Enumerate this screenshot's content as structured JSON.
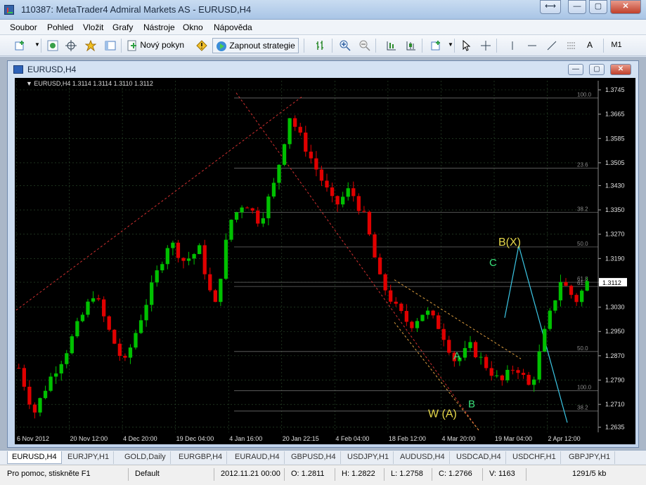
{
  "window": {
    "title": "110387: MetaTrader4 Admiral Markets AS - EURUSD,H4",
    "minimize": "⟷",
    "restore_a": "—",
    "restore_b": "▢",
    "close": "✕"
  },
  "menu": [
    "Soubor",
    "Pohled",
    "Vložit",
    "Grafy",
    "Nástroje",
    "Okno",
    "Nápověda"
  ],
  "toolbar": {
    "new_order": "Nový pokyn",
    "start_strategy": "Zapnout strategie",
    "text_tool": "A",
    "timeframe": "M1",
    "icons": [
      "new-chart-icon",
      "profiles-icon",
      "crosshair-icon",
      "favorites-icon",
      "navigator-icon",
      "warning-icon",
      "expert-icon",
      "bar-chart-icon",
      "zoom-in-icon",
      "zoom-out-icon",
      "grid-icon",
      "candle-icon",
      "templates-icon",
      "cursor-icon",
      "crosshair-tool-icon",
      "vertical-line-icon",
      "horizontal-line-icon",
      "trendline-icon",
      "fibo-icon"
    ]
  },
  "chart_window": {
    "title": "EURUSD,H4",
    "minimize": "—",
    "restore": "▢",
    "close": "✕"
  },
  "chart_data": {
    "type": "candlestick",
    "symbol_info": "EURUSD,H4  1.3114 1.3114 1.3110 1.3112",
    "background": "#000000",
    "up_color": "#00c000",
    "down_color": "#e00000",
    "current_price_label": "1.3112",
    "y_ticks": [
      "1.3745",
      "1.3665",
      "1.3585",
      "1.3505",
      "1.3430",
      "1.3350",
      "1.3270",
      "1.3190",
      "1.3112",
      "1.3030",
      "1.2950",
      "1.2870",
      "1.2790",
      "1.2710",
      "1.2635"
    ],
    "y_tick_values": [
      1.3745,
      1.3665,
      1.3585,
      1.3505,
      1.343,
      1.335,
      1.327,
      1.319,
      1.3112,
      1.303,
      1.295,
      1.287,
      1.279,
      1.271,
      1.2635
    ],
    "ylim": [
      1.2618,
      1.3775
    ],
    "x_ticks": [
      "6 Nov 2012",
      "20 Nov 12:00",
      "4 Dec 20:00",
      "19 Dec 04:00",
      "4 Jan 16:00",
      "20 Jan 22:15",
      "4 Feb 04:00",
      "18 Feb 12:00",
      "4 Mar 20:00",
      "19 Mar 04:00",
      "2 Apr 12:00"
    ],
    "x_tick_index": [
      0,
      10,
      20,
      30,
      40,
      50,
      60,
      70,
      80,
      90,
      100
    ],
    "bar_count": 108,
    "path": [
      [
        0,
        1.283
      ],
      [
        4,
        1.268
      ],
      [
        8,
        1.279
      ],
      [
        12,
        1.287
      ],
      [
        16,
        1.298
      ],
      [
        20,
        1.308
      ],
      [
        24,
        1.295
      ],
      [
        28,
        1.284
      ],
      [
        32,
        1.298
      ],
      [
        36,
        1.312
      ],
      [
        40,
        1.325
      ],
      [
        44,
        1.318
      ],
      [
        48,
        1.322
      ],
      [
        52,
        1.302
      ],
      [
        56,
        1.331
      ],
      [
        60,
        1.338
      ],
      [
        64,
        1.331
      ],
      [
        68,
        1.344
      ],
      [
        72,
        1.366
      ],
      [
        76,
        1.356
      ],
      [
        80,
        1.346
      ],
      [
        84,
        1.336
      ],
      [
        88,
        1.342
      ],
      [
        92,
        1.332
      ],
      [
        96,
        1.312
      ],
      [
        100,
        1.303
      ],
      [
        104,
        1.297
      ],
      [
        108,
        1.302
      ],
      [
        112,
        1.296
      ],
      [
        116,
        1.285
      ],
      [
        120,
        1.29
      ],
      [
        124,
        1.284
      ],
      [
        128,
        1.278
      ],
      [
        132,
        1.284
      ],
      [
        136,
        1.276
      ],
      [
        140,
        1.296
      ],
      [
        144,
        1.312
      ],
      [
        148,
        1.305
      ],
      [
        151,
        1.311
      ]
    ],
    "fibo_levels": [
      {
        "label": "100.0",
        "value": 1.3718
      },
      {
        "label": "23.6",
        "value": 1.3487
      },
      {
        "label": "38.2",
        "value": 1.3342
      },
      {
        "label": "50.0",
        "value": 1.3228
      },
      {
        "label": "61.8",
        "value": 1.3112
      },
      {
        "label": "61.8",
        "value": 1.3098
      },
      {
        "label": "50.0",
        "value": 1.2884
      },
      {
        "label": "100.0",
        "value": 1.2755
      },
      {
        "label": "38.2",
        "value": 1.2688
      }
    ],
    "annotations": [
      {
        "text": "B(X)",
        "color": "#e6d84a"
      },
      {
        "text": "C",
        "color": "#39e07a"
      },
      {
        "text": "A",
        "color": "#39e07a"
      },
      {
        "text": "B",
        "color": "#39e07a"
      },
      {
        "text": "W (A)",
        "color": "#e6d84a"
      }
    ],
    "projection_color": "#3cc8e6",
    "trendline_color": "#d03030",
    "channel_color": "#e0a040"
  },
  "tabs": [
    "EURUSD,H4",
    "EURJPY,H1",
    "GOLD,Daily",
    "EURGBP,H4",
    "EURAUD,H4",
    "GBPUSD,H4",
    "USDJPY,H1",
    "AUDUSD,H4",
    "USDCAD,H4",
    "USDCHF,H1",
    "GBPJPY,H1"
  ],
  "status": {
    "help": "Pro pomoc, stiskněte F1",
    "profile": "Default",
    "datetime": "2012.11.21 00:00",
    "open": "O: 1.2811",
    "high": "H: 1.2822",
    "low": "L: 1.2758",
    "close": "C: 1.2766",
    "volume": "V: 1163",
    "traffic": "1291/5 kb"
  }
}
